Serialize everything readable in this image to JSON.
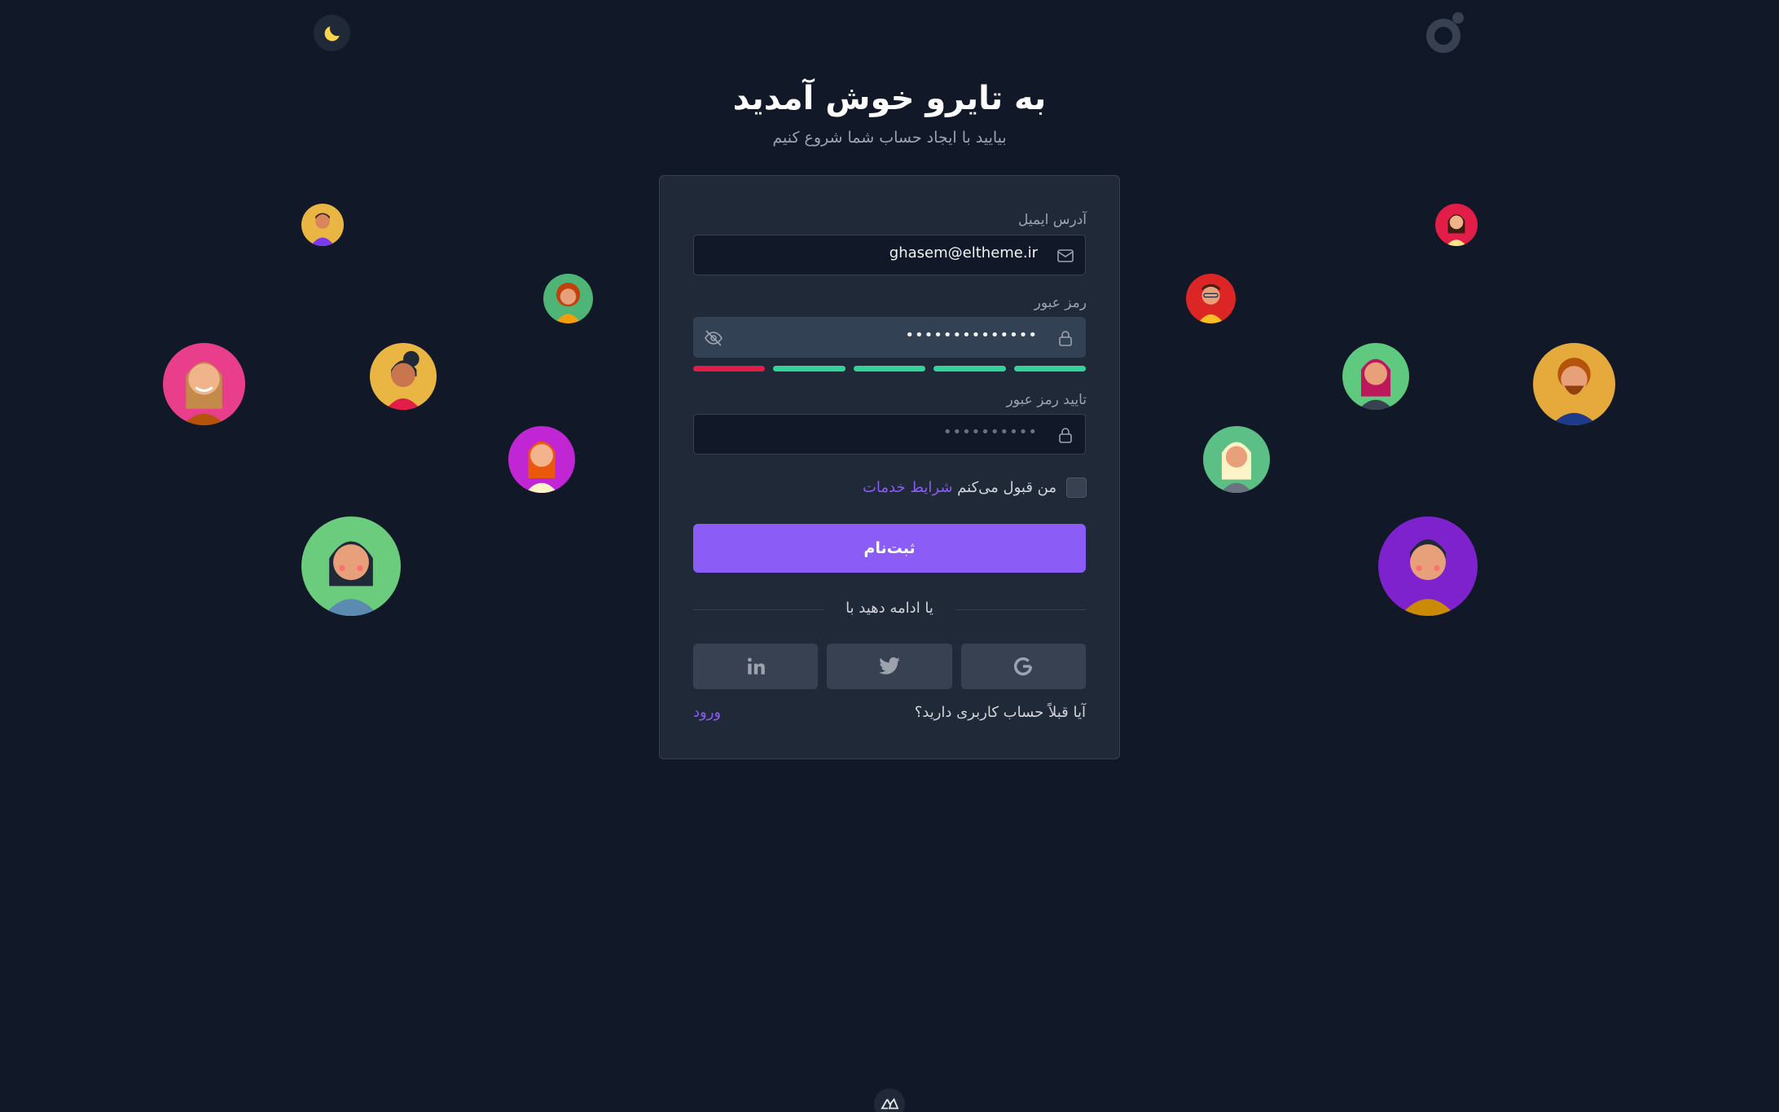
{
  "header": {
    "title": "به تایرو خوش آمدید",
    "subtitle": "بیایید با ایجاد حساب شما شروع کنیم"
  },
  "form": {
    "email_label": "آدرس ایمیل",
    "email_value": "ghasem@eltheme.ir",
    "password_label": "رمز عبور",
    "password_value": "••••••••••••••",
    "strength_segments": [
      "#e11d48",
      "#34d399",
      "#34d399",
      "#34d399",
      "#34d399"
    ],
    "confirm_label": "تایید رمز عبور",
    "confirm_placeholder": "••••••••••",
    "terms_prefix": "من قبول می‌کنم",
    "terms_link": "شرایط خدمات",
    "submit_label": "ثبت‌نام",
    "divider_text": "یا ادامه دهید با",
    "socials": [
      "google-icon",
      "twitter-icon",
      "linkedin-icon"
    ],
    "have_account": "آیا قبلاً حساب کاربری دارید؟",
    "login_link": "ورود"
  },
  "colors": {
    "background": "#111827",
    "card": "#1f2937",
    "accent": "#8b5cf6",
    "moon": "#fcd34d"
  },
  "avatars": [
    {
      "bg": "#e9b543"
    },
    {
      "bg": "#4fb576"
    },
    {
      "bg": "#e83e8c"
    },
    {
      "bg": "#e9b543"
    },
    {
      "bg": "#c026d3"
    },
    {
      "bg": "#6bcc7d"
    },
    {
      "bg": "#e11d48"
    },
    {
      "bg": "#dc2626"
    },
    {
      "bg": "#5ec97f"
    },
    {
      "bg": "#e6a93b"
    },
    {
      "bg": "#5bbf86"
    },
    {
      "bg": "#7e22ce"
    }
  ]
}
